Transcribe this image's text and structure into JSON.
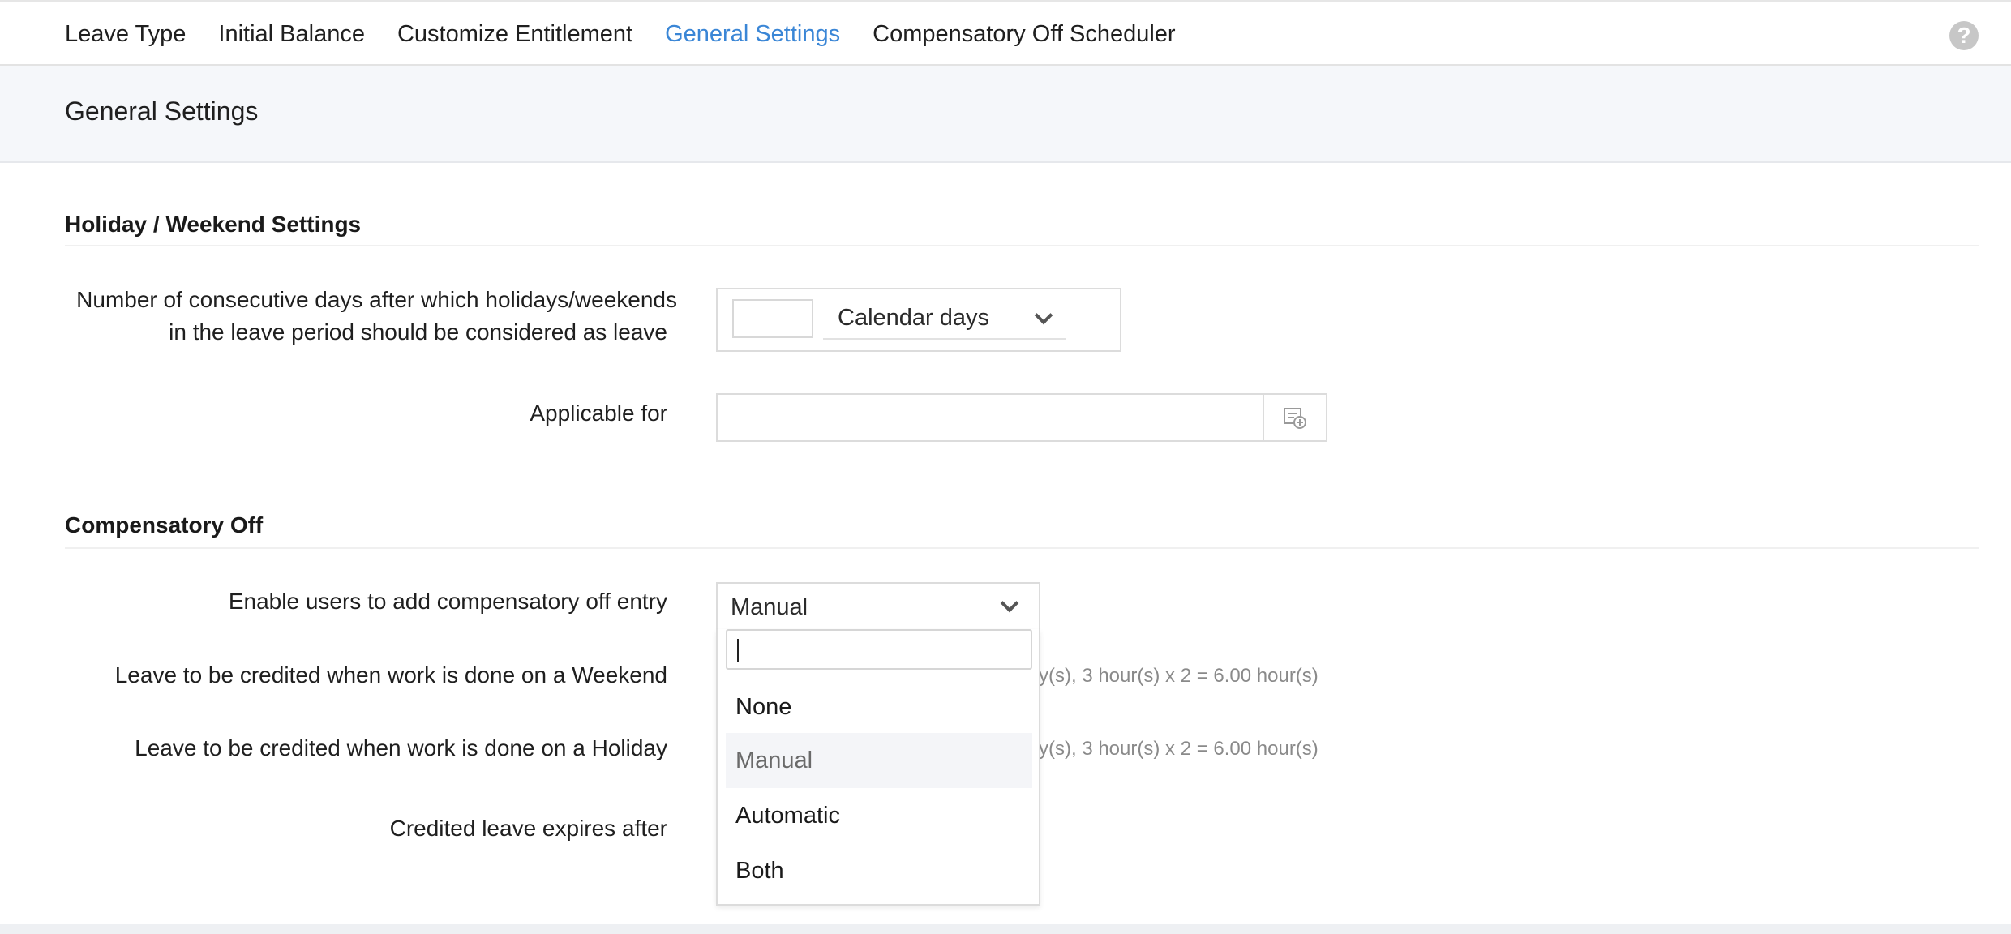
{
  "tabs": [
    {
      "label": "Leave Type"
    },
    {
      "label": "Initial Balance"
    },
    {
      "label": "Customize Entitlement"
    },
    {
      "label": "General Settings",
      "active": true
    },
    {
      "label": "Compensatory Off Scheduler"
    }
  ],
  "help": {
    "glyph": "?"
  },
  "page": {
    "title": "General Settings"
  },
  "holiday": {
    "section_title": "Holiday / Weekend Settings",
    "consecutive_label_1": "Number of consecutive days after which holidays/weekends",
    "consecutive_label_2": "in the leave period should be considered as leave",
    "days_value": "",
    "unit_selected": "Calendar days",
    "applicable_label": "Applicable for",
    "applicable_value": ""
  },
  "comp": {
    "section_title": "Compensatory Off",
    "enable_label": "Enable users to add compensatory off entry",
    "enable_selected": "Manual",
    "weekend_label": "Leave to be credited when work is done on a Weekend",
    "weekend_hint": "y(s), 3 hour(s) x 2 = 6.00 hour(s)",
    "holiday_label": "Leave to be credited when work is done on a Holiday",
    "holiday_hint": "y(s), 3 hour(s) x 2 = 6.00 hour(s)",
    "expires_label": "Credited leave expires after"
  },
  "dropdown": {
    "search_value": "",
    "options": [
      "None",
      "Manual",
      "Automatic",
      "Both"
    ],
    "highlighted": "Manual"
  },
  "colors": {
    "accent": "#3a86d6",
    "header_bg": "#f5f7fa",
    "muted_text": "#8a8a8a"
  }
}
